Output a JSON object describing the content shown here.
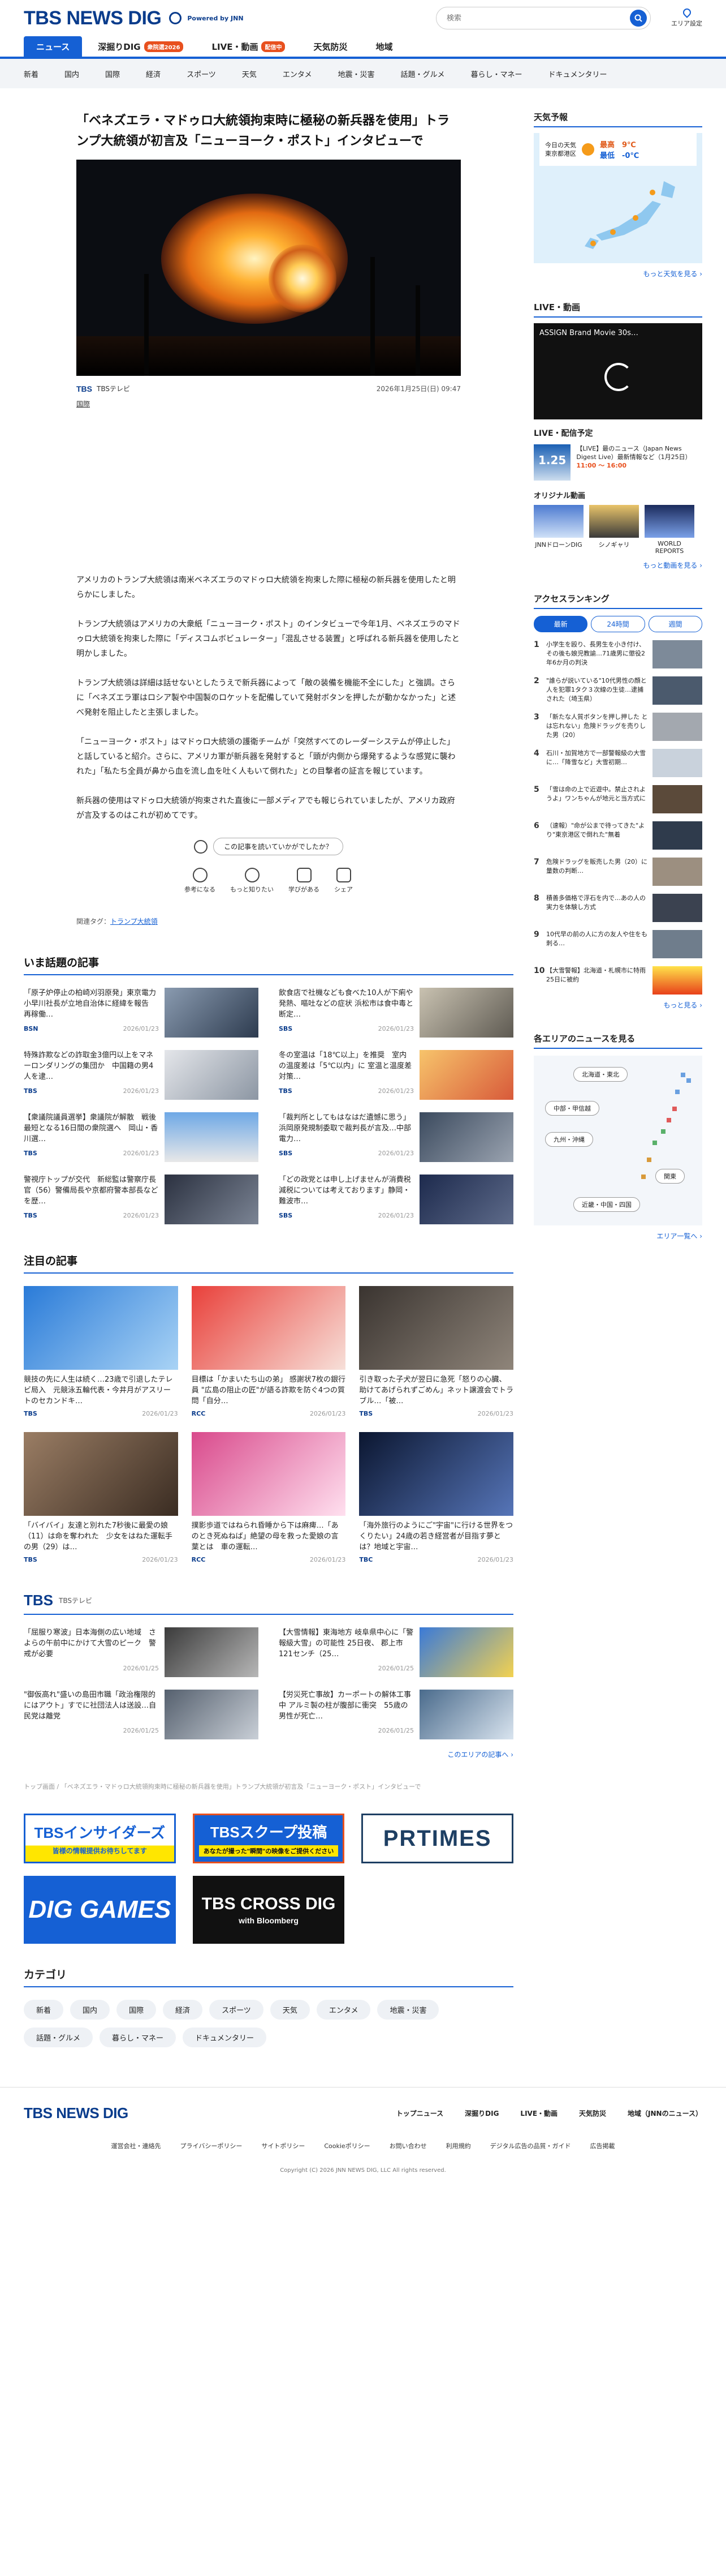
{
  "header": {
    "logo_text": "TBS NEWS DIG",
    "powered_by": "Powered by JNN",
    "search_placeholder": "検索",
    "area_label": "エリア設定"
  },
  "main_nav": [
    {
      "label": "ニュース",
      "badge": ""
    },
    {
      "label": "深掘りDIG",
      "badge": "衆院選2026"
    },
    {
      "label": "LIVE・動画",
      "badge": "配信中"
    },
    {
      "label": "天気防災",
      "badge": ""
    },
    {
      "label": "地域",
      "badge": ""
    }
  ],
  "sub_nav": [
    "新着",
    "国内",
    "国際",
    "経済",
    "スポーツ",
    "天気",
    "エンタメ",
    "地震・災害",
    "話題・グルメ",
    "暮らし・マネー",
    "ドキュメンタリー"
  ],
  "article": {
    "title": "「ベネズエラ・マドゥロ大統領拘束時に極秘の新兵器を使用」トランプ大統領が初言及「ニューヨーク・ポスト」インタビューで",
    "source": "TBSテレビ",
    "date": "2026年1月25日(日) 09:47",
    "region_tag": "国際",
    "paragraphs": [
      "アメリカのトランプ大統領は南米ベネズエラのマドゥロ大統領を拘束した際に極秘の新兵器を使用したと明らかにしました。",
      "トランプ大統領はアメリカの大衆紙「ニューヨーク・ポスト」のインタビューで今年1月、ベネズエラのマドゥロ大統領を拘束した際に「ディスコムボビュレーター」「混乱させる装置」と呼ばれる新兵器を使用したと明かしました。",
      "トランプ大統領は詳細は話せないとしたうえで新兵器によって「敵の装備を機能不全にした」と強調。さらに「ベネズエラ軍はロシア製や中国製のロケットを配備していて発射ボタンを押したが動かなかった」と述べ発射を阻止したと主張しました。",
      "「ニューヨーク・ポスト」はマドゥロ大統領の護衛チームが「突然すべてのレーダーシステムが停止した」と話していると紹介。さらに、アメリカ軍が新兵器を発射すると「頭が内側から爆発するような感覚に襲われた」「私たち全員が鼻から血を流し血を吐く人もいて倒れた」との目撃者の証言を報じています。",
      "新兵器の使用はマドゥロ大統領が拘束された直後に一部メディアでも報じられていましたが、アメリカ政府が言及するのはこれが初めてです。"
    ],
    "feedback_question": "この記事を読いていかがでしたか？",
    "reactions": [
      "参考になる",
      "もっと知りたい",
      "学びがある",
      "シェア"
    ],
    "related_label": "関連タグ：",
    "related_tag": "トランプ大統領"
  },
  "trending": {
    "title": "いま話題の記事",
    "items": [
      {
        "text": "「原子炉停止の柏崎刈羽原発」東京電力 小早川社長が立地自治体に経緯を報告　再稼働…",
        "src": "BSN",
        "date": "2026/01/23"
      },
      {
        "text": "飲食店で社機なども食べた10人が下痢や発熱、嘔吐などの症状 浜松市は食中毒と断定…",
        "src": "SBS",
        "date": "2026/01/23"
      },
      {
        "text": "特殊詐欺などの詐取金3億円以上をマネーロンダリングの集団か　中国籍の男4人を逮…",
        "src": "TBS",
        "date": "2026/01/23"
      },
      {
        "text": "冬の室温は「18℃以上」を推奨　室内の温度差は「5℃以内」に 室温と温度差対策…",
        "src": "TBS",
        "date": "2026/01/23"
      },
      {
        "text": "【衆議院議員選挙】衆議院が解散　戦後最短となる16日間の衆院選へ　岡山・香川選…",
        "src": "TBS",
        "date": "2026/01/23"
      },
      {
        "text": "「裁判所としてもはなはだ遺憾に思う」浜岡原発規制委取で裁判長が言及…中部電力…",
        "src": "SBS",
        "date": "2026/01/23"
      },
      {
        "text": "警視庁トップが交代　新総監は警察庁長官（56）警備局長や京都府警本部長などを歴…",
        "src": "TBS",
        "date": "2026/01/23"
      },
      {
        "text": "「どの政党とは申し上げませんが消費税減税については考えております」静岡・難波市…",
        "src": "SBS",
        "date": "2026/01/23"
      }
    ]
  },
  "featured": {
    "title": "注目の記事",
    "items": [
      {
        "text": "競技の先に人生は続く…23歳で引退したテレビ局入　元競泳五輪代表・今井月がアスリートのセカンドキ…",
        "src": "TBS",
        "date": "2026/01/23"
      },
      {
        "text": "目標は「かまいたち山の弟」 感謝状7枚の銀行員 \"広島の阻止の匠\"が語る詐欺を防ぐ4つの質問「自分…",
        "src": "RCC",
        "date": "2026/01/23"
      },
      {
        "text": "引き取った子犬が翌日に急死「怒りの心臓、助けてあげられずごめん」ネット譲渡会でトラブル…「被…",
        "src": "TBS",
        "date": "2026/01/23"
      },
      {
        "text": "「バイバイ」友達と別れた7秒後に最愛の娘（11）は命を奪われた　少女をはねた運転手の男（29）は…",
        "src": "TBS",
        "date": "2026/01/23"
      },
      {
        "text": "撲影歩道ではねられ昏睡から下は麻痺…「あのとき死ぬねば」絶望の母を救った愛娘の言葉とは　車の運転…",
        "src": "RCC",
        "date": "2026/01/23"
      },
      {
        "text": "「海外旅行のようにご\"宇宙\"に行ける世界をつくりたい」24歳の若き経営者が目指す夢とは？地域と宇宙…",
        "src": "TBC",
        "date": "2026/01/23"
      }
    ]
  },
  "tbs_section": {
    "title": "TBS",
    "subtitle": "TBSテレビ",
    "items": [
      {
        "text": "「屈服り寒波」日本海側の広い地域　さよらの午前中にかけて大雪のピーク　警戒が必要",
        "date": "2026/01/25"
      },
      {
        "text": "【大雪情報】東海地方 岐阜県中心に「警報級大雪」の可能性 25日夜、 郡上市121センチ（25…",
        "date": "2026/01/25"
      },
      {
        "text": "\"御仮高れ\"盛いの島田市職「政治権限的にはアウト」すでに社団法人は送設…自民党は離党",
        "date": "2026/01/25"
      },
      {
        "text": "【労災死亡事故】カーポートの解体工事中 アルミ製の柱が腹部に衝突　55歳の男性が死亡…",
        "date": "2026/01/25"
      }
    ],
    "more": "このエリアの記事へ ›"
  },
  "breadcrumb": "トップ画面 / 「ベネズエラ・マドゥロ大統領拘束時に極秘の新兵器を使用」トランプ大統領が初言及「ニューヨーク・ポスト」インタビューで",
  "banners": {
    "insiders": "TBSインサイダーズ",
    "insiders_sub": "皆様の情報提供お待ちしてます",
    "scoop": "TBSスクープ投稿",
    "scoop_sub": "あなたが撮った\"瞬間\"の映像をご提供ください",
    "prtimes": "PRTIMES",
    "diggames": "DIG GAMES",
    "crossdig": "TBS CROSS DIG",
    "crossdig_sub": "with Bloomberg"
  },
  "categories": {
    "title": "カテゴリ",
    "items": [
      "新着",
      "国内",
      "国際",
      "経済",
      "スポーツ",
      "天気",
      "エンタメ",
      "地震・災害",
      "話題・グルメ",
      "暮らし・マネー",
      "ドキュメンタリー"
    ]
  },
  "sidebar": {
    "weather_title": "天気予報",
    "weather_loc1": "今日の天気",
    "weather_loc2": "東京都港区",
    "weather_hi": "最高　9℃",
    "weather_lo": "最低　-0℃",
    "weather_more": "もっと天気を見る ›",
    "live_title": "LIVE・動画",
    "live_video_title": "ASSIGN Brand Movie 30s…",
    "live_sched_title": "LIVE・配信予定",
    "sched_text": "【LIVE】最のニュース（Japan News Digest Live）最新情報など（1月25日）",
    "sched_time": "11:00 ～ 16:00",
    "sched_date": "1.25",
    "orig_title": "オリジナル動画",
    "orig_items": [
      "JNNドローンDIG",
      "シノギャリ",
      "WORLD REPORTS"
    ],
    "live_more": "もっと動画を見る ›",
    "rank_title": "アクセスランキング",
    "rank_tabs": [
      "最新",
      "24時間",
      "週間"
    ],
    "rank_items": [
      "小学生を殴り、長男生を小き付け、その後も娘児教諭…71歳男に懲役2年6か月の判決",
      "\"誰らが説いている\"10代男性の顔と人を犯罪1タク３次線の生徒…逮捕された（埼玉県）",
      "「新たな人質ボタンを押し押した とは忘れない」危険ドラッグを売りした男（20）",
      "石川・加賀地方で一部警報級の大雪に…「降雪など」大雪初期…",
      "「雪は命の上で近遊中。禁止されようよ」ワンちゃんが地元と当方式に",
      "（速報）\"命が公まで待ってきた\"より\"東京港区で倒れた\"無着",
      "危険ドラッグを販売した男（20）に量数の判断…",
      "積善多価格で浮石を内で…あの人の実力を体験し方式",
      "10代早の前の人に方の友人や住をも刺る…",
      "【大雪警報】北海道・札幌市に特雨 25日に被約"
    ],
    "rank_more": "もっと見る ›",
    "area_title": "各エリアのニュースを見る",
    "area_chips": [
      "北海道・東北",
      "中部・甲信越",
      "九州・沖縄",
      "関東",
      "近畿・中国・四国"
    ],
    "area_more": "エリア一覧へ ›"
  },
  "footer": {
    "links": [
      "トップニュース",
      "深掘りDIG",
      "LIVE・動画",
      "天気防災",
      "地域（JNNのニュース）"
    ],
    "bottom_links": [
      "運営会社・連絡先",
      "プライバシーポリシー",
      "サイトポリシー",
      "Cookieポリシー",
      "お問い合わせ",
      "利用規約",
      "デジタル広告の品質・ガイド",
      "広告掲載"
    ],
    "copyright": "Copyright (C) 2026 JNN NEWS DIG, LLC All rights reserved."
  }
}
